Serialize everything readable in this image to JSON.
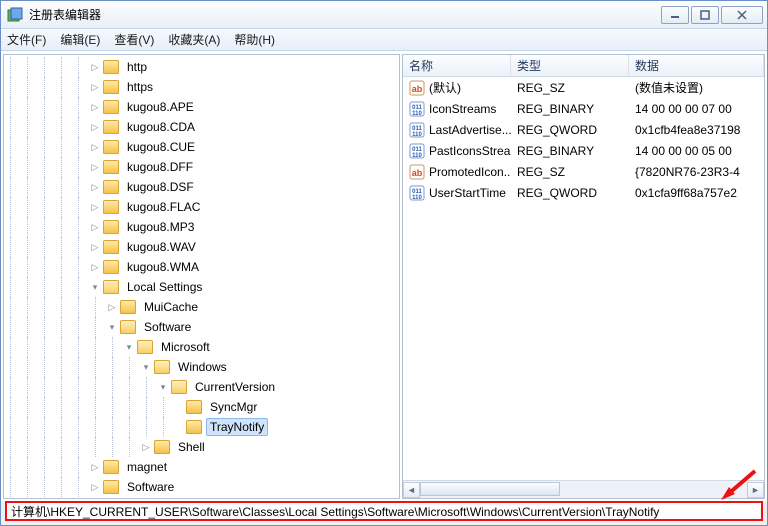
{
  "window": {
    "title": "注册表编辑器"
  },
  "menu": {
    "file": "文件(F)",
    "edit": "编辑(E)",
    "view": "查看(V)",
    "fav": "收藏夹(A)",
    "help": "帮助(H)"
  },
  "cols": {
    "name": "名称",
    "type": "类型",
    "data": "数据"
  },
  "values": [
    {
      "kind": "sz",
      "name": "(默认)",
      "type": "REG_SZ",
      "data": "(数值未设置)"
    },
    {
      "kind": "bin",
      "name": "IconStreams",
      "type": "REG_BINARY",
      "data": "14 00 00 00 07 00 "
    },
    {
      "kind": "bin",
      "name": "LastAdvertise...",
      "type": "REG_QWORD",
      "data": "0x1cfb4fea8e37198"
    },
    {
      "kind": "bin",
      "name": "PastIconsStream",
      "type": "REG_BINARY",
      "data": "14 00 00 00 05 00 "
    },
    {
      "kind": "sz",
      "name": "PromotedIcon...",
      "type": "REG_SZ",
      "data": "{7820NR76-23R3-4"
    },
    {
      "kind": "bin",
      "name": "UserStartTime",
      "type": "REG_QWORD",
      "data": "0x1cfa9ff68a757e2"
    }
  ],
  "tree": [
    {
      "depth": 5,
      "toggle": "▷",
      "label": "http"
    },
    {
      "depth": 5,
      "toggle": "▷",
      "label": "https"
    },
    {
      "depth": 5,
      "toggle": "▷",
      "label": "kugou8.APE"
    },
    {
      "depth": 5,
      "toggle": "▷",
      "label": "kugou8.CDA"
    },
    {
      "depth": 5,
      "toggle": "▷",
      "label": "kugou8.CUE"
    },
    {
      "depth": 5,
      "toggle": "▷",
      "label": "kugou8.DFF"
    },
    {
      "depth": 5,
      "toggle": "▷",
      "label": "kugou8.DSF"
    },
    {
      "depth": 5,
      "toggle": "▷",
      "label": "kugou8.FLAC"
    },
    {
      "depth": 5,
      "toggle": "▷",
      "label": "kugou8.MP3"
    },
    {
      "depth": 5,
      "toggle": "▷",
      "label": "kugou8.WAV"
    },
    {
      "depth": 5,
      "toggle": "▷",
      "label": "kugou8.WMA"
    },
    {
      "depth": 5,
      "toggle": "▾",
      "open": true,
      "label": "Local Settings"
    },
    {
      "depth": 6,
      "toggle": "▷",
      "label": "MuiCache"
    },
    {
      "depth": 6,
      "toggle": "▾",
      "open": true,
      "label": "Software"
    },
    {
      "depth": 7,
      "toggle": "▾",
      "open": true,
      "label": "Microsoft"
    },
    {
      "depth": 8,
      "toggle": "▾",
      "open": true,
      "label": "Windows"
    },
    {
      "depth": 9,
      "toggle": "▾",
      "open": true,
      "label": "CurrentVersion"
    },
    {
      "depth": 10,
      "toggle": "",
      "label": "SyncMgr"
    },
    {
      "depth": 10,
      "toggle": "",
      "label": "TrayNotify",
      "selected": true
    },
    {
      "depth": 8,
      "toggle": "▷",
      "label": "Shell"
    },
    {
      "depth": 5,
      "toggle": "▷",
      "label": "magnet"
    },
    {
      "depth": 5,
      "toggle": "▷",
      "label": "Software"
    }
  ],
  "status": "计算机\\HKEY_CURRENT_USER\\Software\\Classes\\Local Settings\\Software\\Microsoft\\Windows\\CurrentVersion\\TrayNotify"
}
